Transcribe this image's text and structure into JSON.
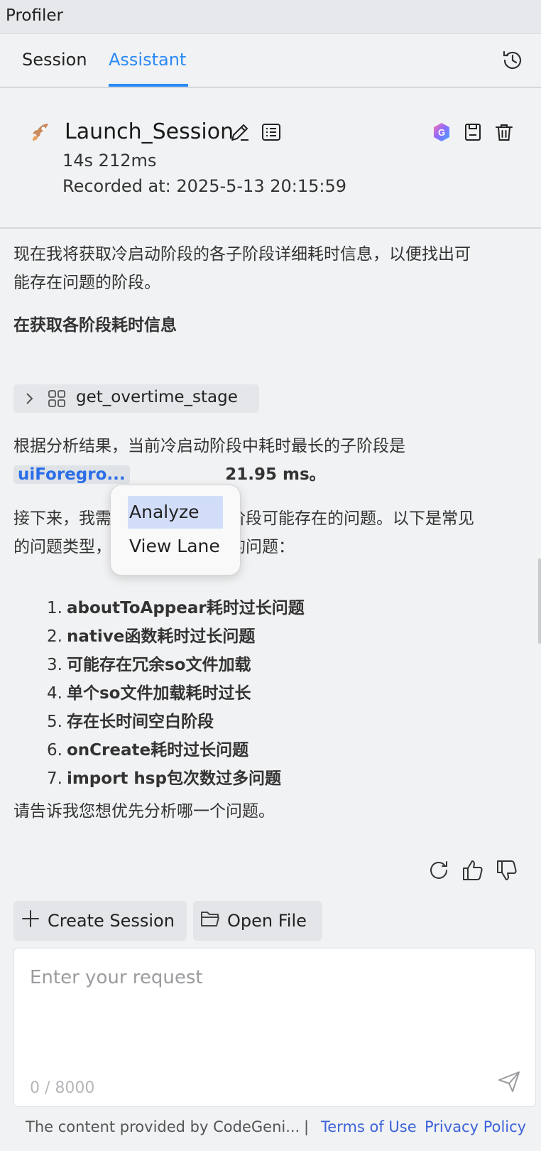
{
  "window": {
    "title": "Profiler"
  },
  "tabs": [
    {
      "label": "Session",
      "active": false
    },
    {
      "label": "Assistant",
      "active": true
    }
  ],
  "icons": {
    "history": "history-icon",
    "rocket": "rocket-icon",
    "edit": "edit-icon",
    "list": "list-icon",
    "ai": "codegenie-icon",
    "save": "save-icon",
    "delete": "trash-icon",
    "tool": "grid-icon",
    "refresh": "refresh-icon",
    "like": "thumbs-up-icon",
    "dislike": "thumbs-down-icon",
    "plus": "plus-icon",
    "folder": "folder-icon",
    "send": "send-icon"
  },
  "session": {
    "name": "Launch_Session",
    "duration": "14s 212ms",
    "recorded": "Recorded at: 2025-5-13 20:15:59"
  },
  "chat": {
    "intro_line1": "现在我将获取冷启动阶段的各子阶段详细耗时信息，以便找出可",
    "intro_line2": "能存在问题的阶段。",
    "status": "在获取各阶段耗时信息",
    "tool_call": "get_overtime_stage",
    "result_line1": "根据分析结果，当前冷启动阶段中耗时最长的子阶段是",
    "result_chip": "uiForegro...",
    "result_tail": "21.95 ms。",
    "next_line1_a": "接下来，我需",
    "next_line1_b": "阶段可能存在的问题。以下是常见",
    "next_line2_a": "的问题类型，",
    "next_line2_b": "的问题：",
    "issues": [
      {
        "num": "1.",
        "text": "aboutToAppear耗时过长问题"
      },
      {
        "num": "2.",
        "text": "native函数耗时过长问题"
      },
      {
        "num": "3.",
        "text": "可能存在冗余so文件加载"
      },
      {
        "num": "4.",
        "text": "单个so文件加载耗时过长"
      },
      {
        "num": "5.",
        "text": "存在长时间空白阶段"
      },
      {
        "num": "6.",
        "text": "onCreate耗时过长问题"
      },
      {
        "num": "7.",
        "text": "import hsp包次数过多问题"
      }
    ],
    "closing": "请告诉我您想优先分析哪一个问题。"
  },
  "context_menu": {
    "items": [
      {
        "label": "Analyze",
        "selected": true
      },
      {
        "label": "View Lane",
        "selected": false
      }
    ]
  },
  "actions": {
    "create_session": "Create Session",
    "open_file": "Open File"
  },
  "input": {
    "placeholder": "Enter your request",
    "counter": "0 / 8000"
  },
  "footer": {
    "notice": "The content provided by CodeGeni...",
    "separator": "|",
    "terms": "Terms of Use",
    "privacy": "Privacy Policy"
  },
  "colors": {
    "accent": "#2a8af6",
    "link": "#3d63d9",
    "selection": "#d2def9",
    "background": "#f1f2f3"
  }
}
